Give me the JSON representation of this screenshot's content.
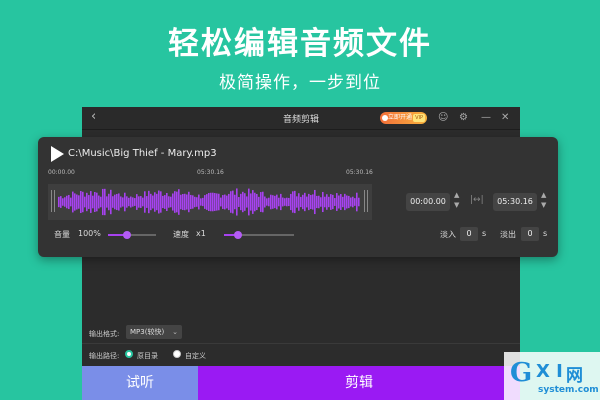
{
  "promo": {
    "headline": "轻松编辑音频文件",
    "subline": "极简操作，一步到位"
  },
  "window": {
    "title": "音频剪辑",
    "back_icon": "chevron-left-icon",
    "vip_badge": {
      "text": "立即开通",
      "tag": "VIP"
    },
    "icons": [
      "user-icon",
      "gear-icon",
      "minimize-icon",
      "close-icon"
    ]
  },
  "player": {
    "filename": "C:\\Music\\Big Thief - Mary.mp3",
    "ticks": [
      "00:00.00",
      "05:30.16",
      "05:30.16"
    ],
    "start_time": "00:00.00",
    "end_time": "05:30.16",
    "volume_label": "音量",
    "volume_value": "100%",
    "volume_level": 0.4,
    "speed_label": "速度",
    "speed_value": "x1",
    "speed_level": 0.2,
    "fade_in_label": "淡入",
    "fade_in_value": "0",
    "fade_out_label": "淡出",
    "fade_out_value": "0",
    "unit": "s",
    "accent": "#a742f0"
  },
  "output": {
    "format_label": "输出格式:",
    "format_value": "MP3(较快)",
    "path_label": "输出路径:",
    "path_options": [
      {
        "label": "原目录",
        "selected": true
      },
      {
        "label": "自定义",
        "selected": false
      }
    ]
  },
  "actions": {
    "try_label": "试听",
    "cut_label": "剪辑"
  },
  "watermark": {
    "logo_g": "G",
    "logo_xi": "X I",
    "logo_cn": "网",
    "url": "system.com"
  },
  "colors": {
    "background": "#27c5a0",
    "cut_button": "#9a1af3",
    "try_button": "#7a8ee8"
  }
}
